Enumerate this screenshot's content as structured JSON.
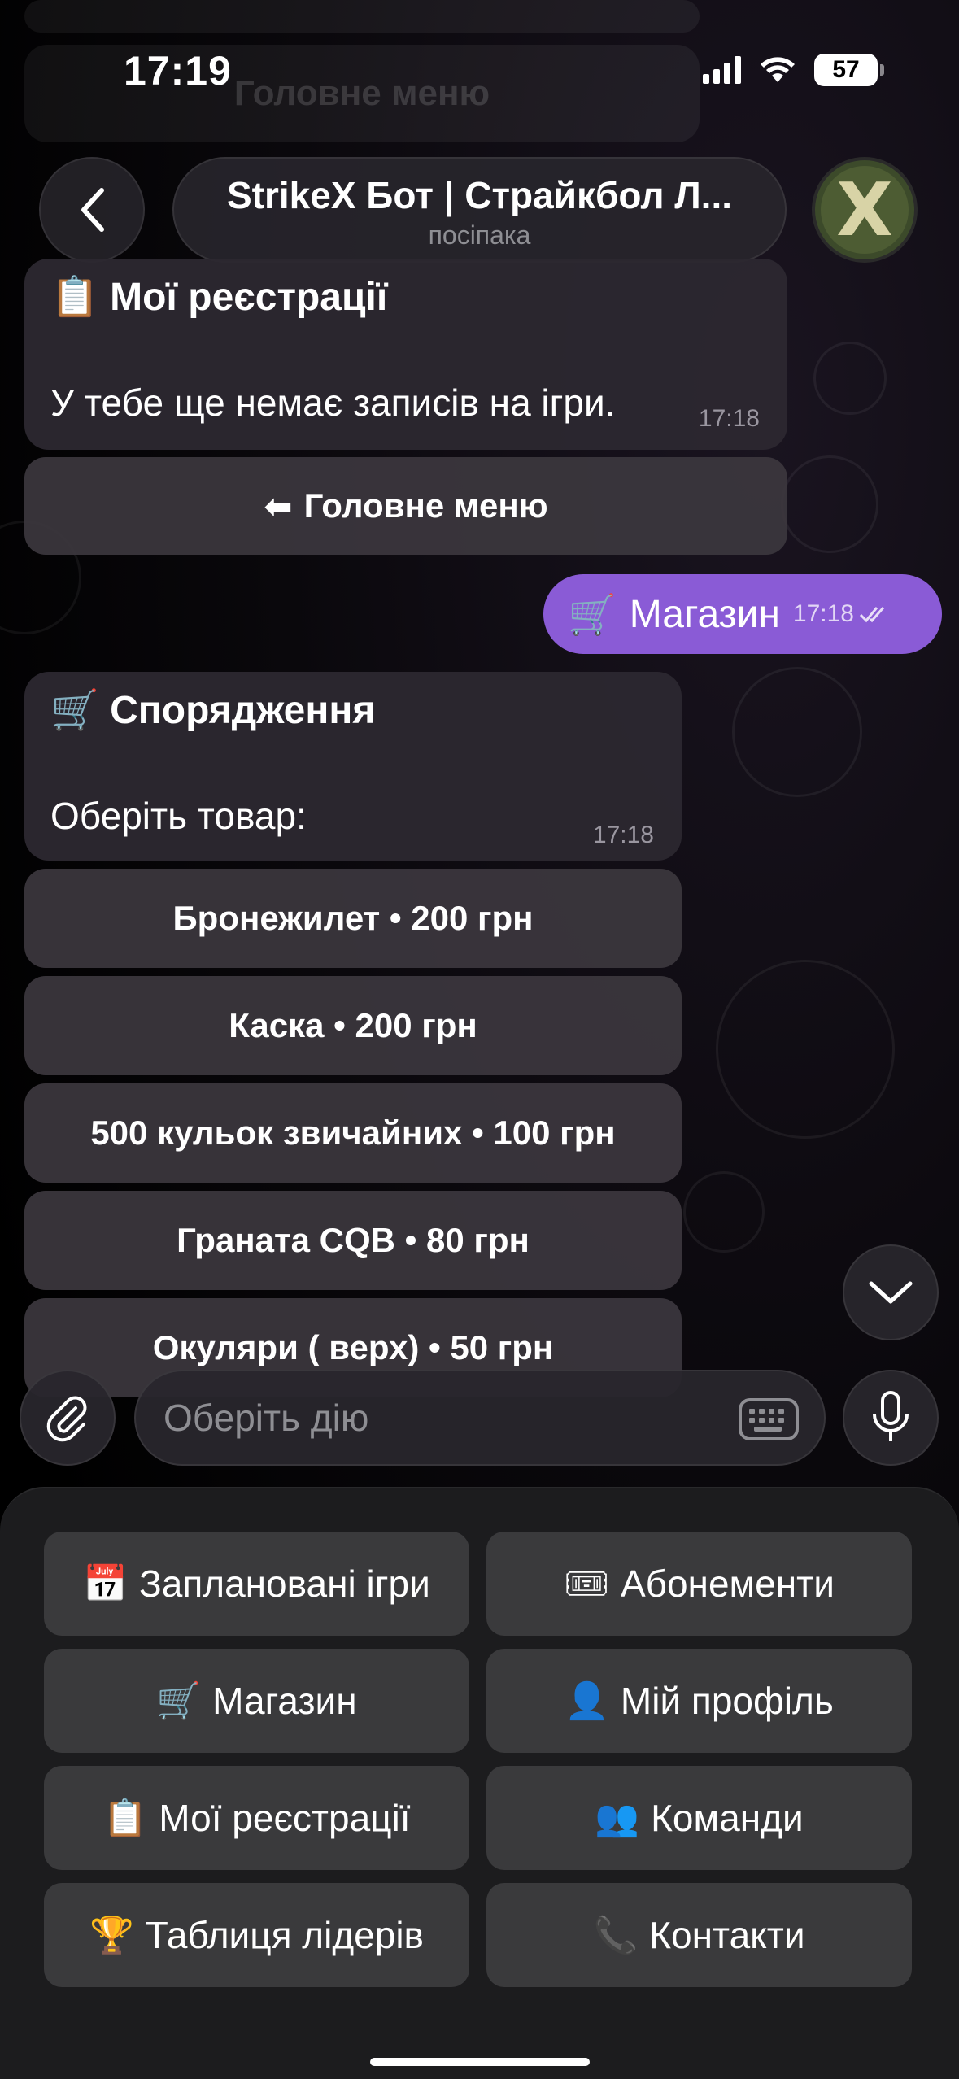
{
  "status_bar": {
    "time": "17:19",
    "battery": "57"
  },
  "header": {
    "title": "StrikeX Бот | Страйкбол Л...",
    "subtitle": "посіпака",
    "avatar_letter": "X"
  },
  "ghost_text": "Головне меню",
  "messages": {
    "registrations": {
      "icon": "📋",
      "title": "Мої реєстрації",
      "text": "У тебе ще немає записів на ігри.",
      "time": "17:18",
      "button_icon": "⬅",
      "button": "Головне меню"
    },
    "outgoing": {
      "icon": "🛒",
      "text": "Магазин",
      "time": "17:18"
    },
    "shop": {
      "icon": "🛒",
      "title": "Спорядження",
      "text": "Оберіть товар:",
      "time": "17:18",
      "items": [
        "Бронежилет • 200 грн",
        "Каска • 200 грн",
        "500 кульок звичайних • 100 грн",
        "Граната CQB • 80 грн",
        "Окуляри ( верх) • 50 грн"
      ]
    }
  },
  "input": {
    "placeholder": "Оберіть дію"
  },
  "reply_keyboard": [
    {
      "icon": "📅",
      "label": "Заплановані ігри"
    },
    {
      "icon": "🎟",
      "label": "Абонементи"
    },
    {
      "icon": "🛒",
      "label": "Магазин"
    },
    {
      "icon": "👤",
      "label": "Мій профіль"
    },
    {
      "icon": "📋",
      "label": "Мої реєстрації"
    },
    {
      "icon": "👥",
      "label": "Команди"
    },
    {
      "icon": "🏆",
      "label": "Таблиця лідерів"
    },
    {
      "icon": "📞",
      "label": "Контакти"
    }
  ],
  "colors": {
    "accent": "#8a5bd6",
    "bubble": "#2c2830",
    "keyboard": "#1c1c1e",
    "key": "#3a3a3c"
  }
}
